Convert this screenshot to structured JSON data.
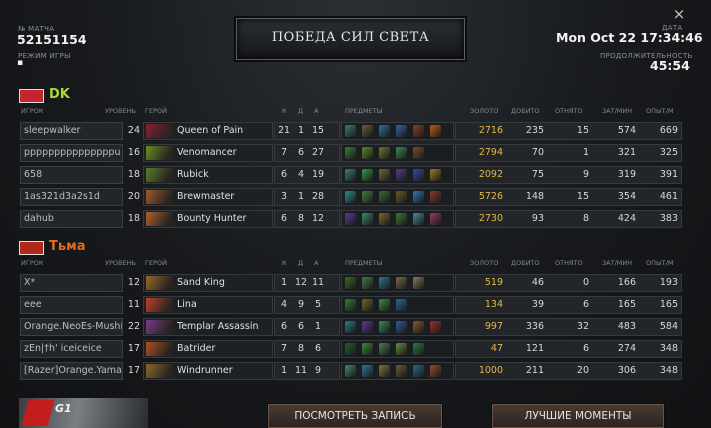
{
  "header": {
    "match_id_label": "№ МАТЧА",
    "match_id": "52151154",
    "game_mode_label": "РЕЖИМ ИГРЫ",
    "game_mode": "▪",
    "title": "ПОБЕДА СИЛ СВЕТА",
    "date_label": "ДАТА",
    "date": "Mon Oct 22 17:34:46",
    "duration_label": "ПРОДОЛЖИТЕЛЬНОСТЬ",
    "duration": "45:54",
    "close_icon": "×"
  },
  "columns": {
    "player": "ИГРОК",
    "level": "УРОВЕНЬ",
    "hero": "ГЕРОЙ",
    "k": "К",
    "d": "Д",
    "a": "А",
    "items": "ПРЕДМЕТЫ",
    "gold": "ЗОЛОТО",
    "last_hits": "ДОБИТО",
    "denies": "ОТНЯТО",
    "xpm": "ЗАТ/МИН",
    "gpm": "ОПЫТ/М"
  },
  "teams": [
    {
      "name": "DK",
      "color": "#a9d83a",
      "logo_color": "#c0282c",
      "players": [
        {
          "player": "sleepwalker",
          "level": "24",
          "hero": "Queen of Pain",
          "hero_color": "#8a1e2e",
          "k": "21",
          "d": "1",
          "a": "15",
          "gold": "2716",
          "last_hits": "235",
          "denies": "15",
          "gpm": "574",
          "xpm": "669",
          "items": [
            "#3a7f6a",
            "#6b5a3c",
            "#2e6da0",
            "#3d5fa3",
            "#8a3f2a",
            "#c85a1e"
          ]
        },
        {
          "player": "pppppppppppppppu",
          "level": "16",
          "hero": "Venomancer",
          "hero_color": "#6b8f23",
          "k": "7",
          "d": "6",
          "a": "27",
          "gold": "2794",
          "last_hits": "70",
          "denies": "1",
          "gpm": "321",
          "xpm": "325",
          "items": [
            "#3b7d3a",
            "#5a8a2a",
            "#6b7c2c",
            "#3f8a4a",
            "#7a4f2a"
          ]
        },
        {
          "player": "658",
          "level": "18",
          "hero": "Rubick",
          "hero_color": "#5a7d2a",
          "k": "6",
          "d": "4",
          "a": "19",
          "gold": "2092",
          "last_hits": "75",
          "denies": "9",
          "gpm": "319",
          "xpm": "391",
          "items": [
            "#3a7f6a",
            "#2f9a4a",
            "#6a6f2a",
            "#5a3a8a",
            "#3f4aa0",
            "#9a7a2a"
          ]
        },
        {
          "player": "1as321d3a2s1d",
          "level": "20",
          "hero": "Brewmaster",
          "hero_color": "#a05a2a",
          "k": "3",
          "d": "1",
          "a": "28",
          "gold": "5726",
          "last_hits": "148",
          "denies": "15",
          "gpm": "354",
          "xpm": "461",
          "items": [
            "#2f8a8a",
            "#4a7a3a",
            "#3a6a3a",
            "#6a5a2a",
            "#2e7ab0",
            "#8a3a2a"
          ]
        },
        {
          "player": "dahub",
          "level": "18",
          "hero": "Bounty Hunter",
          "hero_color": "#b0622a",
          "k": "6",
          "d": "8",
          "a": "12",
          "gold": "2730",
          "last_hits": "93",
          "denies": "8",
          "gpm": "424",
          "xpm": "383",
          "items": [
            "#5a3a9a",
            "#3a8a6a",
            "#7a6a2a",
            "#3a7a3a",
            "#4a8a9a",
            "#9a3a6a"
          ]
        }
      ]
    },
    {
      "name": "Тьма",
      "color": "#e06b20",
      "logo_color": "#b02a1a",
      "players": [
        {
          "player": "X*",
          "level": "12",
          "hero": "Sand King",
          "hero_color": "#9a6a2a",
          "k": "1",
          "d": "12",
          "a": "11",
          "gold": "519",
          "last_hits": "46",
          "denies": "0",
          "gpm": "166",
          "xpm": "193",
          "items": [
            "#3a6a2a",
            "#4a7a4a",
            "#2a7a9a",
            "#7a6a4a",
            "#8a7a5a"
          ]
        },
        {
          "player": "eee",
          "level": "11",
          "hero": "Lina",
          "hero_color": "#c0402a",
          "k": "4",
          "d": "9",
          "a": "5",
          "gold": "134",
          "last_hits": "39",
          "denies": "6",
          "gpm": "165",
          "xpm": "165",
          "items": [
            "#3a7a3a",
            "#6a6a2a",
            "#3a8a4a",
            "#2a6a9a"
          ]
        },
        {
          "player": "Orange.NeoEs-Mushi",
          "level": "22",
          "hero": "Templar Assassin",
          "hero_color": "#7a3a8a",
          "k": "6",
          "d": "6",
          "a": "1",
          "gold": "997",
          "last_hits": "336",
          "denies": "32",
          "gpm": "483",
          "xpm": "584",
          "items": [
            "#2a7a8a",
            "#5a3a9a",
            "#3a8a5a",
            "#2e5aa0",
            "#8a5a2a",
            "#a0302a"
          ]
        },
        {
          "player": "zEn|†h' iceiceice",
          "level": "17",
          "hero": "Batrider",
          "hero_color": "#b05020",
          "k": "7",
          "d": "8",
          "a": "6",
          "gold": "47",
          "last_hits": "121",
          "denies": "6",
          "gpm": "274",
          "xpm": "348",
          "items": [
            "#2a5a2a",
            "#3a8a3a",
            "#4a7a5a",
            "#6a8a3a",
            "#2a7a4a"
          ]
        },
        {
          "player": "[Razer]Orange.Yamate",
          "level": "17",
          "hero": "Windrunner",
          "hero_color": "#8a6a2a",
          "k": "1",
          "d": "11",
          "a": "9",
          "gold": "1000",
          "last_hits": "211",
          "denies": "20",
          "gpm": "306",
          "xpm": "348",
          "items": [
            "#3a8a6a",
            "#2a7a9a",
            "#7a7a3a",
            "#6a5a3a",
            "#2a6a8a",
            "#9a4a2a"
          ]
        }
      ]
    }
  ],
  "buttons": {
    "watch_replay": "ПОСМОТРЕТЬ ЗАПИСЬ",
    "highlights": "ЛУЧШИЕ МОМЕНТЫ"
  },
  "sponsor": "G1"
}
